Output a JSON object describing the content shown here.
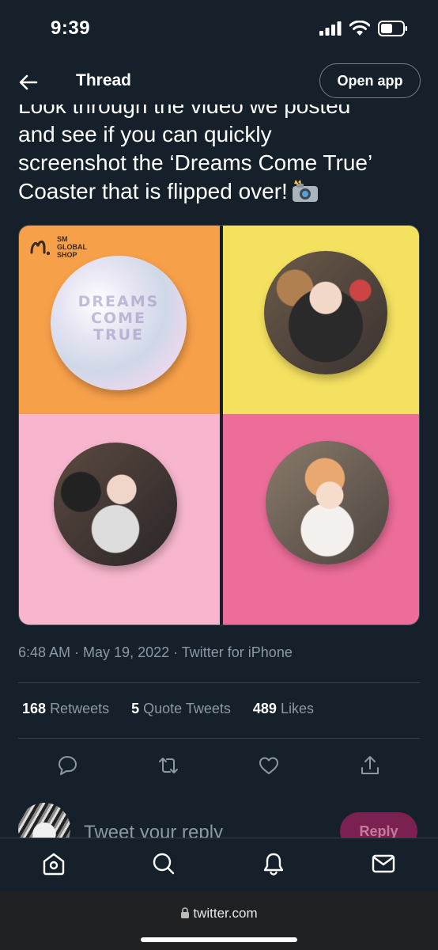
{
  "status_bar": {
    "time": "9:39"
  },
  "header": {
    "title": "Thread",
    "open_app_label": "Open app"
  },
  "tweet": {
    "text": "Look through the video we posted\nand see if you can quickly\nscreenshot the ‘Dreams Come True’\nCoaster that is flipped over!",
    "media": {
      "logo_text": "SM\nGLOBAL\nSHOP",
      "coaster_text": "DREAMS\nCOME\nTRUE"
    },
    "meta": "6:48 AM · May 19, 2022 · Twitter for iPhone",
    "stats": [
      {
        "count": "168",
        "label": "Retweets"
      },
      {
        "count": "5",
        "label": "Quote Tweets"
      },
      {
        "count": "489",
        "label": "Likes"
      }
    ]
  },
  "reply": {
    "placeholder": "Tweet your reply",
    "button_label": "Reply"
  },
  "browser": {
    "url": "twitter.com"
  },
  "colors": {
    "background": "#15202b",
    "muted_text": "#8b98a5",
    "divider": "#38444d",
    "reply_button": "#7b2151"
  }
}
